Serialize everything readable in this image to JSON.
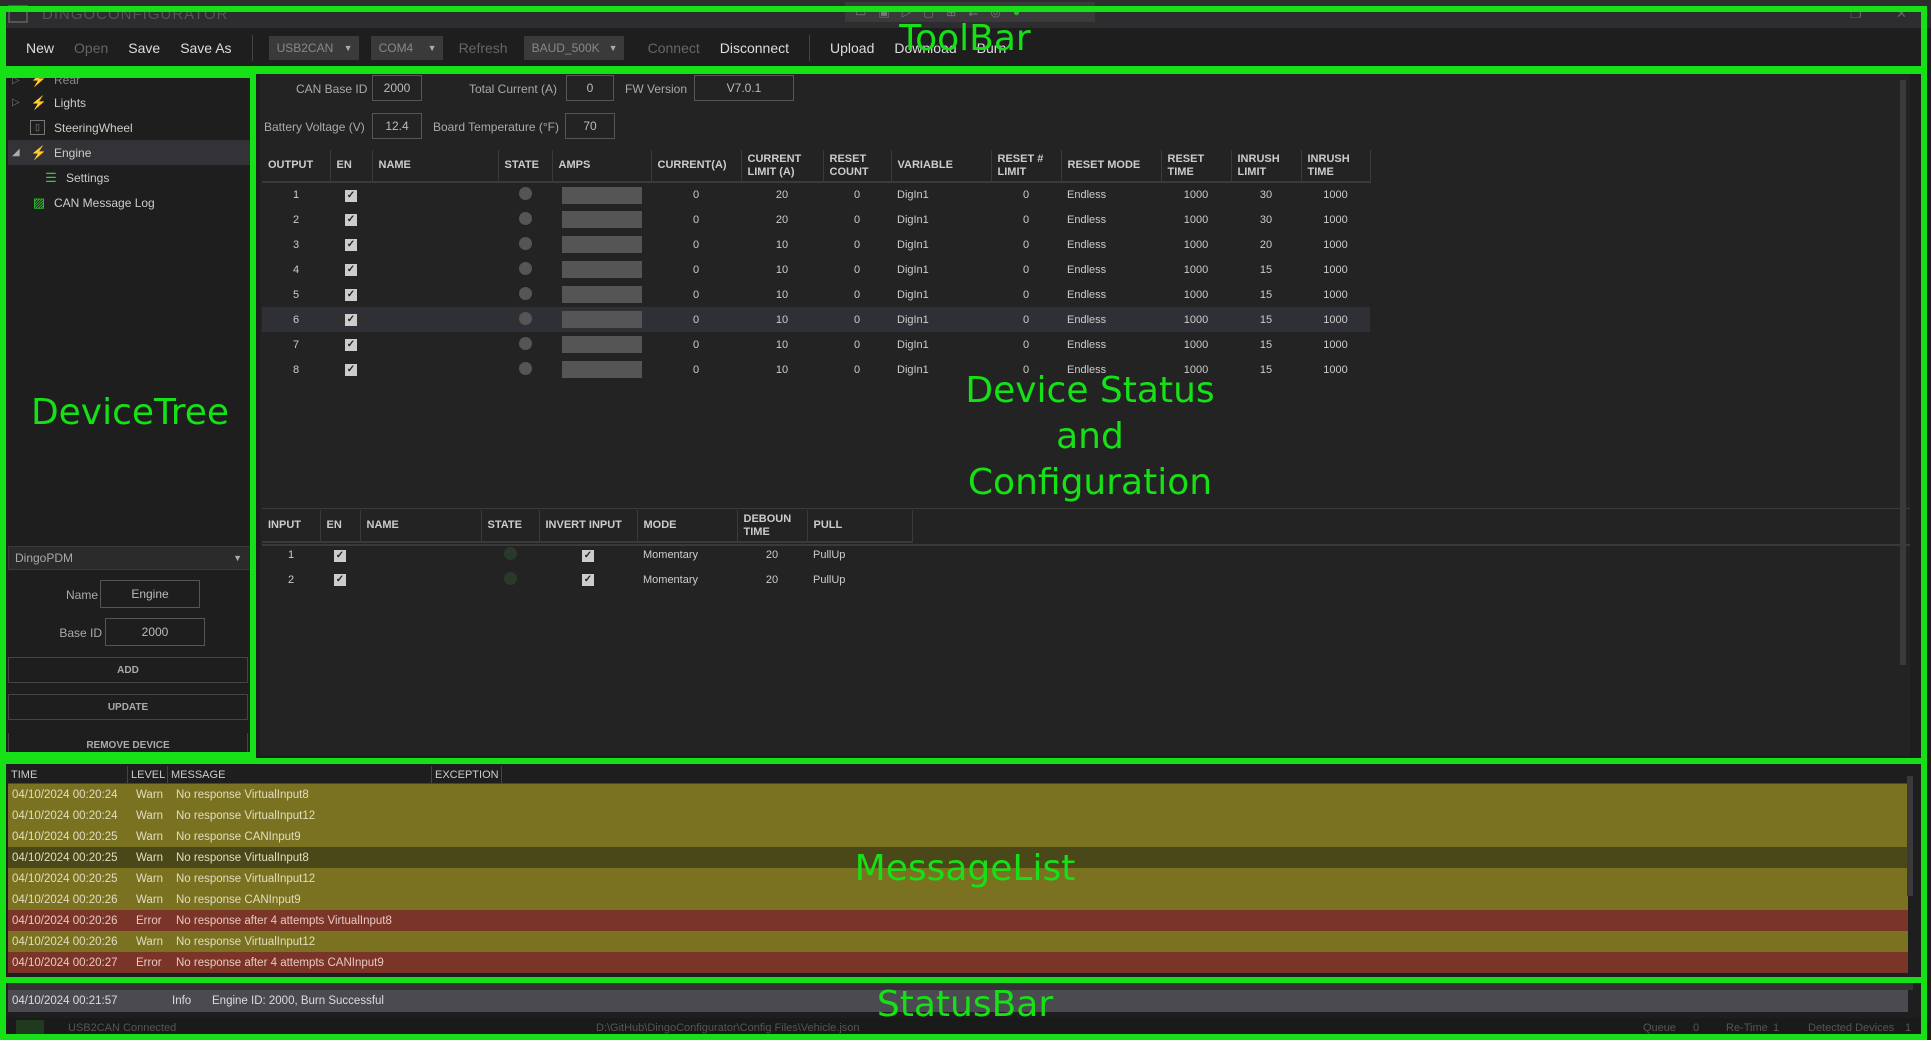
{
  "app": {
    "title": "DINGOCONFIGURATOR"
  },
  "toolbar": {
    "new": "New",
    "open": "Open",
    "save": "Save",
    "save_as": "Save As",
    "adapter": "USB2CAN",
    "port": "COM4",
    "refresh": "Refresh",
    "baud": "BAUD_500K",
    "connect": "Connect",
    "disconnect": "Disconnect",
    "upload": "Upload",
    "download": "Download",
    "burn": "Burn"
  },
  "tree": {
    "items": [
      {
        "label": "Rear"
      },
      {
        "label": "Lights"
      },
      {
        "label": "SteeringWheel"
      },
      {
        "label": "Engine"
      },
      {
        "label": "Settings"
      },
      {
        "label": "CAN Message Log"
      }
    ]
  },
  "device_panel": {
    "type": "DingoPDM",
    "name_label": "Name",
    "name_value": "Engine",
    "baseid_label": "Base ID",
    "baseid_value": "2000",
    "add": "ADD",
    "update": "UPDATE",
    "remove": "REMOVE DEVICE"
  },
  "config": {
    "can_base_id_label": "CAN Base ID",
    "can_base_id": "2000",
    "total_current_label": "Total Current (A)",
    "total_current": "0",
    "fw_version_label": "FW Version",
    "fw_version": "V7.0.1",
    "battery_voltage_label": "Battery Voltage (V)",
    "battery_voltage": "12.4",
    "board_temp_label": "Board Temperature (°F)",
    "board_temp": "70"
  },
  "outputs": {
    "headers": [
      "OUTPUT",
      "EN",
      "NAME",
      "STATE",
      "AMPS",
      "CURRENT(A)",
      "CURRENT LIMIT (A)",
      "RESET COUNT",
      "VARIABLE",
      "RESET # LIMIT",
      "RESET MODE",
      "RESET TIME",
      "INRUSH LIMIT",
      "INRUSH TIME"
    ],
    "rows": [
      {
        "num": "1",
        "current": "0",
        "limit": "20",
        "reset_count": "0",
        "variable": "DigIn1",
        "reset_limit": "0",
        "mode": "Endless",
        "reset_time": "1000",
        "inrush_limit": "30",
        "inrush_time": "1000"
      },
      {
        "num": "2",
        "current": "0",
        "limit": "20",
        "reset_count": "0",
        "variable": "DigIn1",
        "reset_limit": "0",
        "mode": "Endless",
        "reset_time": "1000",
        "inrush_limit": "30",
        "inrush_time": "1000"
      },
      {
        "num": "3",
        "current": "0",
        "limit": "10",
        "reset_count": "0",
        "variable": "DigIn1",
        "reset_limit": "0",
        "mode": "Endless",
        "reset_time": "1000",
        "inrush_limit": "20",
        "inrush_time": "1000"
      },
      {
        "num": "4",
        "current": "0",
        "limit": "10",
        "reset_count": "0",
        "variable": "DigIn1",
        "reset_limit": "0",
        "mode": "Endless",
        "reset_time": "1000",
        "inrush_limit": "15",
        "inrush_time": "1000"
      },
      {
        "num": "5",
        "current": "0",
        "limit": "10",
        "reset_count": "0",
        "variable": "DigIn1",
        "reset_limit": "0",
        "mode": "Endless",
        "reset_time": "1000",
        "inrush_limit": "15",
        "inrush_time": "1000"
      },
      {
        "num": "6",
        "current": "0",
        "limit": "10",
        "reset_count": "0",
        "variable": "DigIn1",
        "reset_limit": "0",
        "mode": "Endless",
        "reset_time": "1000",
        "inrush_limit": "15",
        "inrush_time": "1000"
      },
      {
        "num": "7",
        "current": "0",
        "limit": "10",
        "reset_count": "0",
        "variable": "DigIn1",
        "reset_limit": "0",
        "mode": "Endless",
        "reset_time": "1000",
        "inrush_limit": "15",
        "inrush_time": "1000"
      },
      {
        "num": "8",
        "current": "0",
        "limit": "10",
        "reset_count": "0",
        "variable": "DigIn1",
        "reset_limit": "0",
        "mode": "Endless",
        "reset_time": "1000",
        "inrush_limit": "15",
        "inrush_time": "1000"
      }
    ]
  },
  "inputs": {
    "headers": [
      "INPUT",
      "EN",
      "NAME",
      "STATE",
      "INVERT INPUT",
      "MODE",
      "DEBOUN TIME",
      "PULL"
    ],
    "rows": [
      {
        "num": "1",
        "mode": "Momentary",
        "debounce": "20",
        "pull": "PullUp"
      },
      {
        "num": "2",
        "mode": "Momentary",
        "debounce": "20",
        "pull": "PullUp"
      }
    ]
  },
  "messages": {
    "headers": [
      "TIME",
      "LEVEL",
      "MESSAGE",
      "EXCEPTION"
    ],
    "rows": [
      {
        "time": "04/10/2024 00:20:24",
        "level": "Warn",
        "message": "No response VirtualInput8"
      },
      {
        "time": "04/10/2024 00:20:24",
        "level": "Warn",
        "message": "No response VirtualInput12"
      },
      {
        "time": "04/10/2024 00:20:25",
        "level": "Warn",
        "message": "No response CANInput9"
      },
      {
        "time": "04/10/2024 00:20:25",
        "level": "Warn",
        "message": "No response VirtualInput8"
      },
      {
        "time": "04/10/2024 00:20:25",
        "level": "Warn",
        "message": "No response VirtualInput12"
      },
      {
        "time": "04/10/2024 00:20:26",
        "level": "Warn",
        "message": "No response CANInput9"
      },
      {
        "time": "04/10/2024 00:20:26",
        "level": "Error",
        "message": "No response after 4 attempts VirtualInput8"
      },
      {
        "time": "04/10/2024 00:20:26",
        "level": "Warn",
        "message": "No response VirtualInput12"
      },
      {
        "time": "04/10/2024 00:20:27",
        "level": "Error",
        "message": "No response after 4 attempts CANInput9"
      }
    ],
    "last": {
      "time": "04/10/2024 00:21:57",
      "level": "Info",
      "message": "Engine ID: 2000, Burn Successful"
    }
  },
  "statusbar": {
    "connection": "USB2CAN Connected",
    "path": "D:\\GitHub\\DingoConfigurator\\Config Files\\Vehicle.json",
    "queue_label": "Queue",
    "queue": "0",
    "retries_label": "Re-Time",
    "retries": "1",
    "detected_label": "Detected Devices",
    "detected": "1"
  },
  "overlay": {
    "toolbar": "ToolBar",
    "devicetree": "DeviceTree",
    "device_status": "Device Status and Configuration",
    "messagelist": "MessageList",
    "statusbar": "StatusBar"
  },
  "colors": {
    "overlay": "#16e016",
    "warn": "#7a7220",
    "error": "#7a3528",
    "info": "#4a4a50"
  }
}
